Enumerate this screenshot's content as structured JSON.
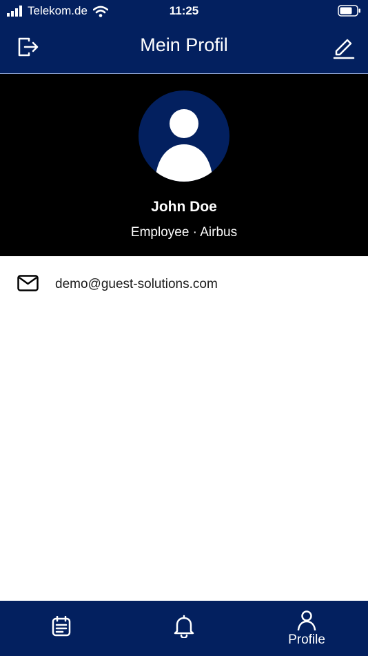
{
  "status_bar": {
    "carrier": "Telekom.de",
    "time": "11:25",
    "icons": [
      "signal-icon",
      "wifi-icon",
      "battery-icon"
    ]
  },
  "header": {
    "title": "Mein Profil",
    "left_icon": "logout-icon",
    "right_icon": "edit-icon"
  },
  "profile": {
    "name": "John Doe",
    "role_company": "Employee · Airbus",
    "avatar_icon": "user-avatar-icon"
  },
  "contact": {
    "email_icon": "mail-icon",
    "email": "demo@guest-solutions.com"
  },
  "tab_bar": {
    "tabs": [
      {
        "icon": "calendar-icon",
        "label": ""
      },
      {
        "icon": "bell-icon",
        "label": ""
      },
      {
        "icon": "person-icon",
        "label": "Profile",
        "active": true
      }
    ]
  },
  "colors": {
    "brand_navy": "#03205f",
    "hero_background": "#000000",
    "page_background": "#ffffff",
    "text_dark": "#1a1a1a"
  }
}
